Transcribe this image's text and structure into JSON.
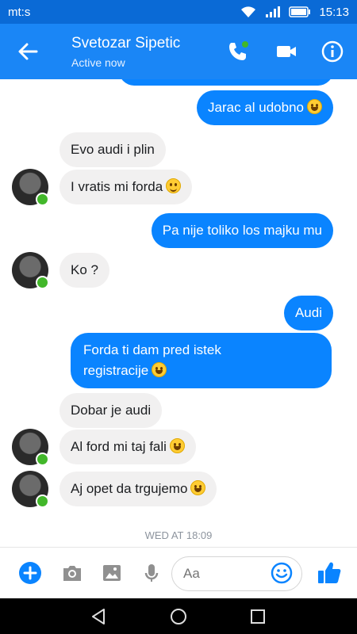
{
  "status_bar": {
    "carrier": "mt:s",
    "time": "15:13"
  },
  "header": {
    "contact_name": "Svetozar Sipetic",
    "contact_status": "Active now"
  },
  "messages": [
    {
      "text": "Jarac al udobno",
      "emoji": "grinning-face"
    },
    {
      "text": "Evo audi i plin"
    },
    {
      "text": "I vratis mi forda",
      "emoji": "smiling-face"
    },
    {
      "text": "Pa nije toliko los majku mu"
    },
    {
      "text": "Ko ?"
    },
    {
      "text": "Audi"
    },
    {
      "text_line1": "Forda ti dam pred istek",
      "text_line2": "registracije",
      "emoji": "grinning-face"
    },
    {
      "text": "Dobar je audi"
    },
    {
      "text": "Al ford mi taj fali",
      "emoji": "grinning-face"
    },
    {
      "text": "Aj opet da trgujemo",
      "emoji": "grinning-face"
    }
  ],
  "timestamp": "WED AT 18:09",
  "composer": {
    "placeholder": "Aa"
  },
  "colors": {
    "header": "#1a86f6",
    "status_bar": "#0a6ad6",
    "outgoing_bubble": "#0a84ff",
    "incoming_bubble": "#f1f0f0",
    "online": "#42b72a"
  }
}
